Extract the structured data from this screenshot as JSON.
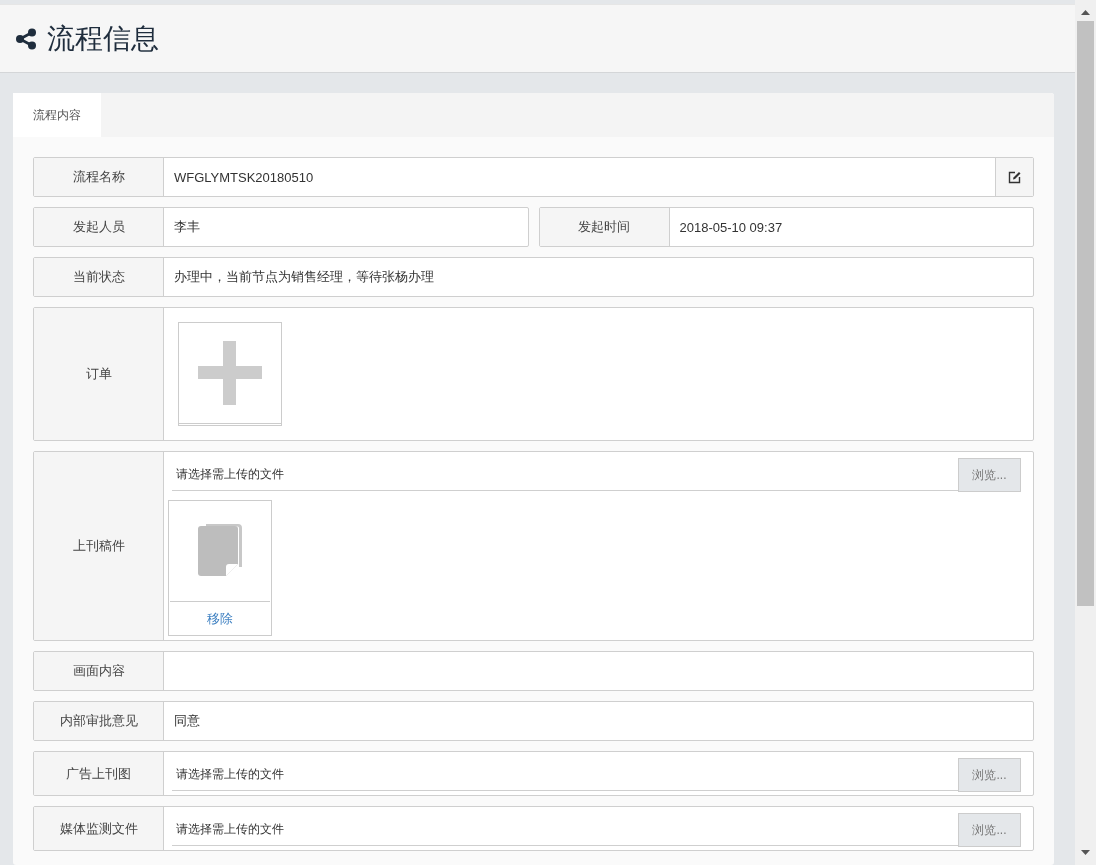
{
  "header": {
    "title": "流程信息"
  },
  "tabs": [
    {
      "label": "流程内容",
      "selected": true
    }
  ],
  "rows": [
    {
      "kind": "text",
      "label": "流程名称",
      "value": "WFGLYMTSK20180510",
      "editable": true
    },
    {
      "kind": "pair",
      "items": [
        {
          "label": "发起人员",
          "value": "李丰"
        },
        {
          "label": "发起时间",
          "value": "2018-05-10 09:37"
        }
      ]
    },
    {
      "kind": "text",
      "label": "当前状态",
      "value": "办理中，当前节点为销售经理，等待张杨办理",
      "editable": false
    },
    {
      "kind": "image",
      "label": "订单"
    },
    {
      "kind": "file",
      "label": "上刊稿件",
      "placeholder": "请选择需上传的文件",
      "button": "浏览...",
      "files": [
        {
          "action": "移除"
        }
      ]
    },
    {
      "kind": "text",
      "label": "画面内容",
      "editable": false
    },
    {
      "kind": "text",
      "label": "内部审批意见",
      "value": "同意",
      "editable": false
    },
    {
      "kind": "file",
      "label": "广告上刊图",
      "placeholder": "请选择需上传的文件",
      "button": "浏览..."
    },
    {
      "kind": "file",
      "label": "媒体监测文件",
      "placeholder": "请选择需上传的文件",
      "button": "浏览..."
    }
  ]
}
